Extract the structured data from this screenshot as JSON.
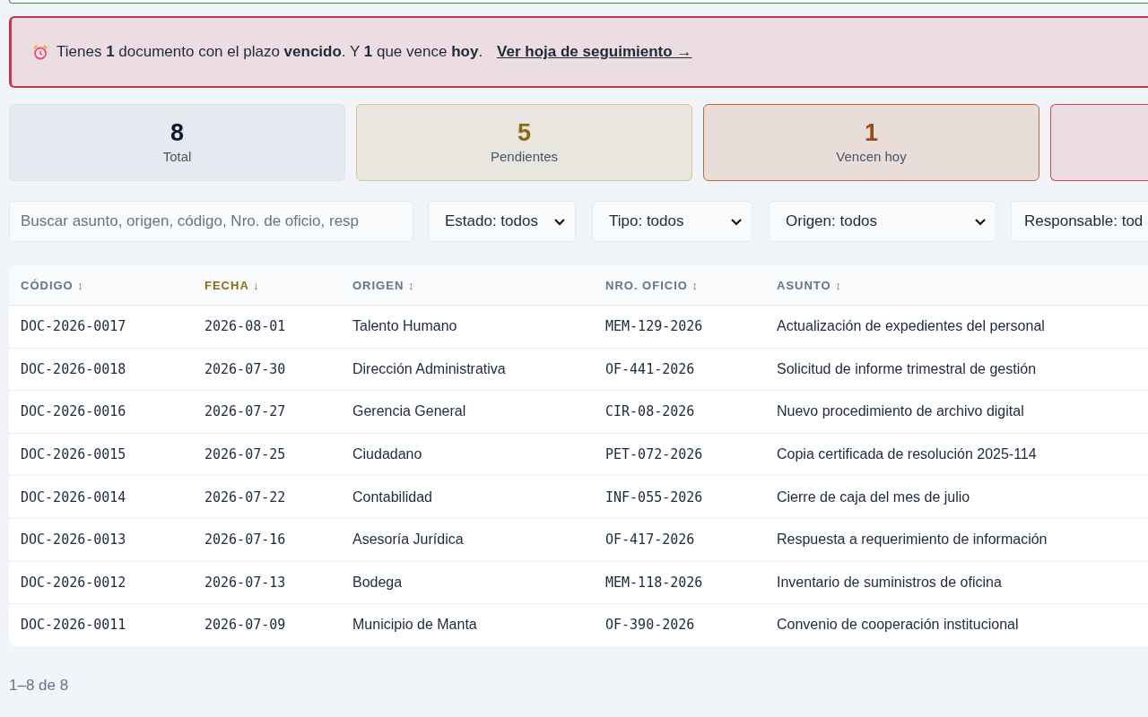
{
  "alert": {
    "message": "Tienes **1** documento con el plazo **vencido**. Y **1** que vence **hoy**.",
    "link": "Ver hoja de seguimiento →"
  },
  "cards": [
    {
      "kind": "total",
      "value": "8",
      "label": "Total"
    },
    {
      "kind": "pending",
      "value": "5",
      "label": "Pendientes"
    },
    {
      "kind": "today",
      "value": "1",
      "label": "Vencen hoy"
    },
    {
      "kind": "overdue"
    }
  ],
  "filters": {
    "search": {
      "placeholder": "Buscar asunto, origen, código, Nro. de oficio, resp"
    },
    "selects": [
      "Estado: todos",
      "Tipo: todos",
      "Origen: todos",
      "Responsable: tod"
    ]
  },
  "table": {
    "columns": [
      {
        "label": "CÓDIGO",
        "sort": "↕",
        "selected": false
      },
      {
        "label": "FECHA",
        "sort": "↓",
        "selected": true
      },
      {
        "label": "ORIGEN",
        "sort": "↕",
        "selected": false
      },
      {
        "label": "NRO. OFICIO",
        "sort": "↕",
        "selected": false
      },
      {
        "label": "ASUNTO",
        "sort": "↕",
        "selected": false
      }
    ],
    "rows": [
      [
        "DOC-2026-0017",
        "2026-08-01",
        "Talento Humano",
        "MEM-129-2026",
        "Actualización de expedientes del personal"
      ],
      [
        "DOC-2026-0018",
        "2026-07-30",
        "Dirección Administrativa",
        "OF-441-2026",
        "Solicitud de informe trimestral de gestión"
      ],
      [
        "DOC-2026-0016",
        "2026-07-27",
        "Gerencia General",
        "CIR-08-2026",
        "Nuevo procedimiento de archivo digital"
      ],
      [
        "DOC-2026-0015",
        "2026-07-25",
        "Ciudadano",
        "PET-072-2026",
        "Copia certificada de resolución 2025-114"
      ],
      [
        "DOC-2026-0014",
        "2026-07-22",
        "Contabilidad",
        "INF-055-2026",
        "Cierre de caja del mes de julio"
      ],
      [
        "DOC-2026-0013",
        "2026-07-16",
        "Asesoría Jurídica",
        "OF-417-2026",
        "Respuesta a requerimiento de información"
      ],
      [
        "DOC-2026-0012",
        "2026-07-13",
        "Bodega",
        "MEM-118-2026",
        "Inventario de suministros de oficina"
      ],
      [
        "DOC-2026-0011",
        "2026-07-09",
        "Municipio de Manta",
        "OF-390-2026",
        "Convenio de cooperación institucional"
      ]
    ]
  },
  "pagination": "1–8 de 8"
}
